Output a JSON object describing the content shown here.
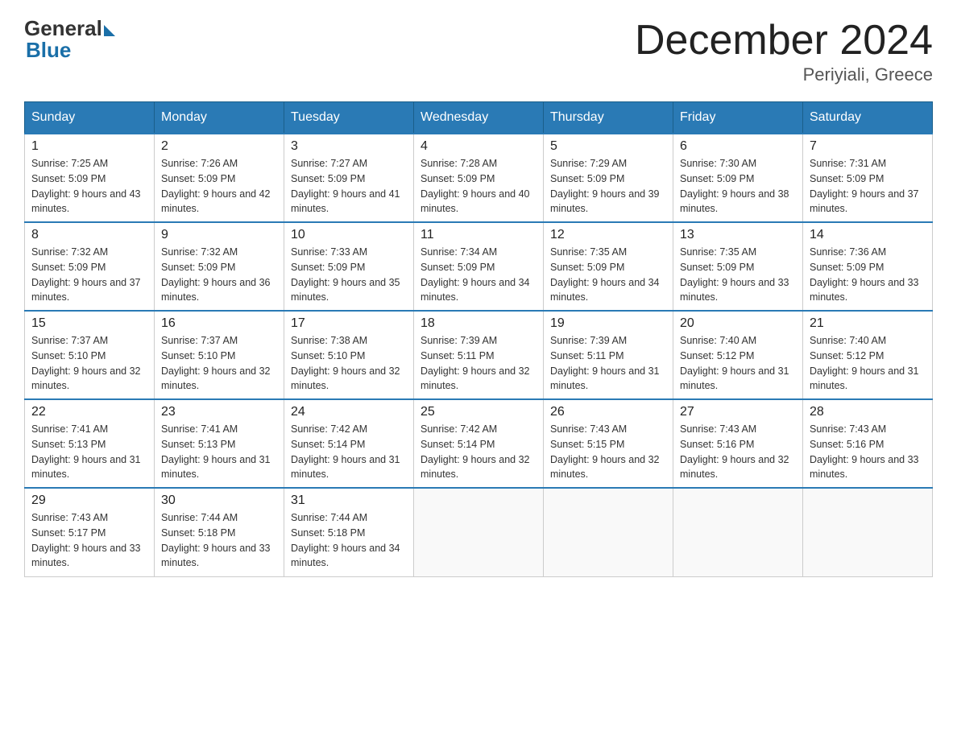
{
  "logo": {
    "general": "General",
    "blue": "Blue"
  },
  "title": "December 2024",
  "location": "Periyiali, Greece",
  "days_of_week": [
    "Sunday",
    "Monday",
    "Tuesday",
    "Wednesday",
    "Thursday",
    "Friday",
    "Saturday"
  ],
  "weeks": [
    [
      {
        "day": "1",
        "sunrise": "7:25 AM",
        "sunset": "5:09 PM",
        "daylight": "9 hours and 43 minutes."
      },
      {
        "day": "2",
        "sunrise": "7:26 AM",
        "sunset": "5:09 PM",
        "daylight": "9 hours and 42 minutes."
      },
      {
        "day": "3",
        "sunrise": "7:27 AM",
        "sunset": "5:09 PM",
        "daylight": "9 hours and 41 minutes."
      },
      {
        "day": "4",
        "sunrise": "7:28 AM",
        "sunset": "5:09 PM",
        "daylight": "9 hours and 40 minutes."
      },
      {
        "day": "5",
        "sunrise": "7:29 AM",
        "sunset": "5:09 PM",
        "daylight": "9 hours and 39 minutes."
      },
      {
        "day": "6",
        "sunrise": "7:30 AM",
        "sunset": "5:09 PM",
        "daylight": "9 hours and 38 minutes."
      },
      {
        "day": "7",
        "sunrise": "7:31 AM",
        "sunset": "5:09 PM",
        "daylight": "9 hours and 37 minutes."
      }
    ],
    [
      {
        "day": "8",
        "sunrise": "7:32 AM",
        "sunset": "5:09 PM",
        "daylight": "9 hours and 37 minutes."
      },
      {
        "day": "9",
        "sunrise": "7:32 AM",
        "sunset": "5:09 PM",
        "daylight": "9 hours and 36 minutes."
      },
      {
        "day": "10",
        "sunrise": "7:33 AM",
        "sunset": "5:09 PM",
        "daylight": "9 hours and 35 minutes."
      },
      {
        "day": "11",
        "sunrise": "7:34 AM",
        "sunset": "5:09 PM",
        "daylight": "9 hours and 34 minutes."
      },
      {
        "day": "12",
        "sunrise": "7:35 AM",
        "sunset": "5:09 PM",
        "daylight": "9 hours and 34 minutes."
      },
      {
        "day": "13",
        "sunrise": "7:35 AM",
        "sunset": "5:09 PM",
        "daylight": "9 hours and 33 minutes."
      },
      {
        "day": "14",
        "sunrise": "7:36 AM",
        "sunset": "5:09 PM",
        "daylight": "9 hours and 33 minutes."
      }
    ],
    [
      {
        "day": "15",
        "sunrise": "7:37 AM",
        "sunset": "5:10 PM",
        "daylight": "9 hours and 32 minutes."
      },
      {
        "day": "16",
        "sunrise": "7:37 AM",
        "sunset": "5:10 PM",
        "daylight": "9 hours and 32 minutes."
      },
      {
        "day": "17",
        "sunrise": "7:38 AM",
        "sunset": "5:10 PM",
        "daylight": "9 hours and 32 minutes."
      },
      {
        "day": "18",
        "sunrise": "7:39 AM",
        "sunset": "5:11 PM",
        "daylight": "9 hours and 32 minutes."
      },
      {
        "day": "19",
        "sunrise": "7:39 AM",
        "sunset": "5:11 PM",
        "daylight": "9 hours and 31 minutes."
      },
      {
        "day": "20",
        "sunrise": "7:40 AM",
        "sunset": "5:12 PM",
        "daylight": "9 hours and 31 minutes."
      },
      {
        "day": "21",
        "sunrise": "7:40 AM",
        "sunset": "5:12 PM",
        "daylight": "9 hours and 31 minutes."
      }
    ],
    [
      {
        "day": "22",
        "sunrise": "7:41 AM",
        "sunset": "5:13 PM",
        "daylight": "9 hours and 31 minutes."
      },
      {
        "day": "23",
        "sunrise": "7:41 AM",
        "sunset": "5:13 PM",
        "daylight": "9 hours and 31 minutes."
      },
      {
        "day": "24",
        "sunrise": "7:42 AM",
        "sunset": "5:14 PM",
        "daylight": "9 hours and 31 minutes."
      },
      {
        "day": "25",
        "sunrise": "7:42 AM",
        "sunset": "5:14 PM",
        "daylight": "9 hours and 32 minutes."
      },
      {
        "day": "26",
        "sunrise": "7:43 AM",
        "sunset": "5:15 PM",
        "daylight": "9 hours and 32 minutes."
      },
      {
        "day": "27",
        "sunrise": "7:43 AM",
        "sunset": "5:16 PM",
        "daylight": "9 hours and 32 minutes."
      },
      {
        "day": "28",
        "sunrise": "7:43 AM",
        "sunset": "5:16 PM",
        "daylight": "9 hours and 33 minutes."
      }
    ],
    [
      {
        "day": "29",
        "sunrise": "7:43 AM",
        "sunset": "5:17 PM",
        "daylight": "9 hours and 33 minutes."
      },
      {
        "day": "30",
        "sunrise": "7:44 AM",
        "sunset": "5:18 PM",
        "daylight": "9 hours and 33 minutes."
      },
      {
        "day": "31",
        "sunrise": "7:44 AM",
        "sunset": "5:18 PM",
        "daylight": "9 hours and 34 minutes."
      },
      null,
      null,
      null,
      null
    ]
  ]
}
